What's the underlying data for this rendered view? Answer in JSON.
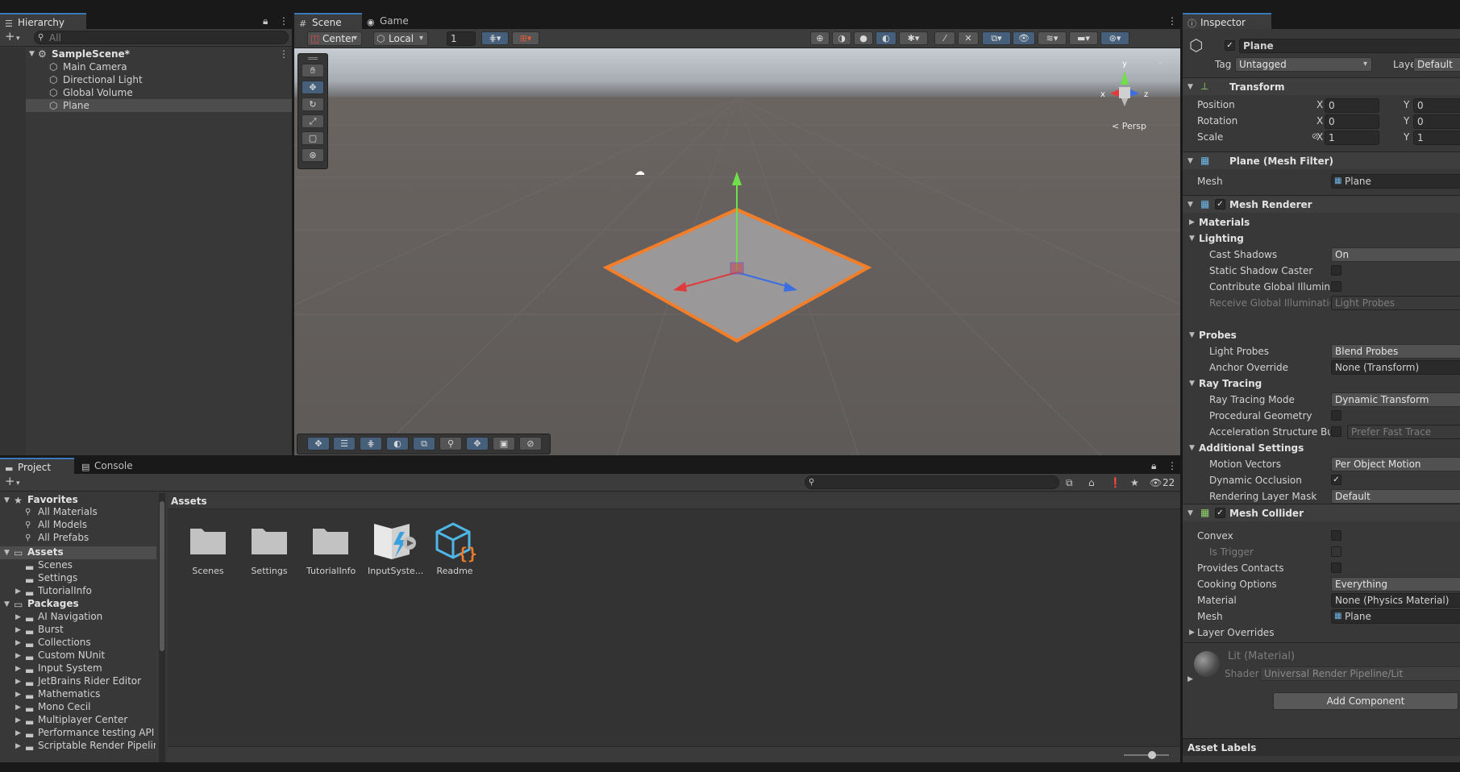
{
  "colors": {
    "accent": "#3a79bb",
    "selection": "#2c5d87",
    "orange": "#f37e29"
  },
  "hierarchy": {
    "tab": "Hierarchy",
    "search_placeholder": "All",
    "scene": "SampleScene*",
    "items": [
      "Main Camera",
      "Directional Light",
      "Global Volume",
      "Plane"
    ]
  },
  "scene_view": {
    "tabs": [
      "Scene",
      "Game"
    ],
    "pivot": "Center",
    "space": "Local",
    "snap_value": "1",
    "persp_label": "< Persp",
    "gizmo_axes": {
      "x": "x",
      "y": "y",
      "z": "z"
    }
  },
  "inspector": {
    "tab": "Inspector",
    "object_name": "Plane",
    "tag_label": "Tag",
    "tag_value": "Untagged",
    "layer_label": "Layer",
    "layer_value": "Default",
    "transform": {
      "title": "Transform",
      "position_label": "Position",
      "rotation_label": "Rotation",
      "scale_label": "Scale",
      "x_label": "X",
      "y_label": "Y",
      "position": {
        "x": "0",
        "y": "0"
      },
      "rotation": {
        "x": "0",
        "y": "0"
      },
      "scale": {
        "x": "1",
        "y": "1"
      }
    },
    "mesh_filter": {
      "title": "Plane (Mesh Filter)",
      "mesh_label": "Mesh",
      "mesh_value": "Plane"
    },
    "mesh_renderer": {
      "title": "Mesh Renderer",
      "materials": "Materials",
      "lighting": "Lighting",
      "cast_shadows_label": "Cast Shadows",
      "cast_shadows_value": "On",
      "static_shadow_label": "Static Shadow Caster",
      "contribute_gi_label": "Contribute Global Illuminat",
      "receive_gi_label": "Receive Global Illuminatior",
      "receive_gi_value": "Light Probes",
      "probes": "Probes",
      "light_probes_label": "Light Probes",
      "light_probes_value": "Blend Probes",
      "anchor_label": "Anchor Override",
      "anchor_value": "None (Transform)",
      "ray_tracing": "Ray Tracing",
      "rt_mode_label": "Ray Tracing Mode",
      "rt_mode_value": "Dynamic Transform",
      "procedural_label": "Procedural Geometry",
      "accel_label": "Acceleration Structure Bui",
      "accel_value": "Prefer Fast Trace",
      "additional": "Additional Settings",
      "motion_label": "Motion Vectors",
      "motion_value": "Per Object Motion",
      "dyn_occ_label": "Dynamic Occlusion",
      "render_layer_label": "Rendering Layer Mask",
      "render_layer_value": "Default"
    },
    "mesh_collider": {
      "title": "Mesh Collider",
      "convex_label": "Convex",
      "trigger_label": "Is Trigger",
      "contacts_label": "Provides Contacts",
      "cooking_label": "Cooking Options",
      "cooking_value": "Everything",
      "material_label": "Material",
      "material_value": "None (Physics Material)",
      "mesh_label": "Mesh",
      "mesh_value": "Plane",
      "layer_overrides": "Layer Overrides"
    },
    "material": {
      "name": "Lit (Material)",
      "shader_label": "Shader",
      "shader_value": "Universal Render Pipeline/Lit"
    },
    "add_component": "Add Component",
    "asset_labels": "Asset Labels"
  },
  "project": {
    "tabs": [
      "Project",
      "Console"
    ],
    "count": "22",
    "favorites": {
      "title": "Favorites",
      "items": [
        "All Materials",
        "All Models",
        "All Prefabs"
      ]
    },
    "assets": {
      "title": "Assets",
      "items": [
        "Scenes",
        "Settings",
        "TutorialInfo"
      ]
    },
    "packages": {
      "title": "Packages",
      "items": [
        "AI Navigation",
        "Burst",
        "Collections",
        "Custom NUnit",
        "Input System",
        "JetBrains Rider Editor",
        "Mathematics",
        "Mono Cecil",
        "Multiplayer Center",
        "Performance testing API",
        "Scriptable Render Pipeline"
      ]
    },
    "breadcrumb": "Assets",
    "grid": [
      "Scenes",
      "Settings",
      "TutorialInfo",
      "InputSyste...",
      "Readme"
    ]
  }
}
